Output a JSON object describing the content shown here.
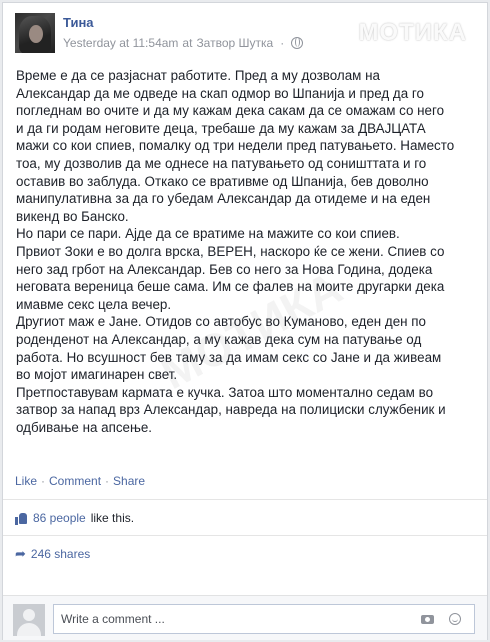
{
  "author": {
    "name": "Тина"
  },
  "meta": {
    "time": "Yesterday at 11:54am",
    "at": "at",
    "place": "Затвор Шутка",
    "dot": "·"
  },
  "watermark": "MОТИКА",
  "watermark_diag": "МОТИКА",
  "post": {
    "text": "Време е да се разјаснат работите. Пред а му дозволам на\nАлександар да ме одведе на скап одмор во Шпанија и пред да го\nпогледнам во очите и да му кажам дека сакам да се омажам со него\nи да ги родам неговите деца, требаше да му кажам за ДВАЈЦАТА\nмажи со кои спиев, помалку од три недели пред патувањето. Наместо\nтоа, му дозволив да ме однесе на патувањето од соништтата и го\nоставив во заблуда. Откако се вративме од Шпанија, бев доволно\nманипулативна за да го убедам Александар да отидеме и на еден\nвикенд во Банско.\nНо пари се пари. Ајде да се вратиме на мажите со кои спиев.\nПрвиот Зоки е во долга врска, ВЕРЕН, наскоро ќе се жени. Спиев со\nнего зад грбот на Александар. Бев со него за Нова Година, додека\nнеговата вереница беше сама. Им се фалев на моите другарки дека\nимавме секс цела вечер.\nДругиот маж е Јане. Отидов со автобус во Куманово, еден ден по\nроденденот на Александар, а му кажав дека сум на патување од\nработа. Но всушност бев таму за да имам секс со Јане и да живеам\nво мојот имагинарен свет.\nПретпоставувам кармата е кучка. Затоа што моментално седам во\nзатвор за напад врз Александар, навреда на полициски службеник и\nодбивање на апсење."
  },
  "actions": {
    "like": "Like",
    "comment": "Comment",
    "share": "Share",
    "sep": "·"
  },
  "likes": {
    "count_label": "86 people",
    "suffix": "like this."
  },
  "shares": {
    "label": "246 shares"
  },
  "comment_box": {
    "placeholder": "Write a comment ..."
  },
  "colors": {
    "link": "#4b67a1",
    "name": "#3b5998"
  },
  "icons": [
    "globe-icon",
    "chevron-down-icon",
    "thumbs-up-icon",
    "share-arrow-icon",
    "camera-icon",
    "smile-icon"
  ]
}
